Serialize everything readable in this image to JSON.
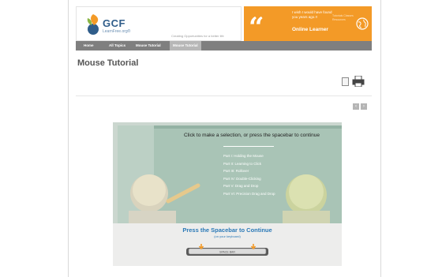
{
  "header": {
    "logo_name": "GCF",
    "logo_sub": "LearnFree.org®",
    "tagline": "Creating Opportunities for a better life",
    "banner_quote": "I wish I would have found you years ago.!!",
    "banner_name": "Online Learner",
    "banner_side": "Tutorials Classes Resources"
  },
  "nav": {
    "items": [
      "Home",
      "All Topics",
      "Mouse Tutorial",
      "Mouse Tutorial"
    ]
  },
  "page": {
    "title": "Mouse Tutorial"
  },
  "tutorial": {
    "heading": "Click to make a selection, or press the spacebar to continue",
    "menu": [
      "Part I: Holding the Mouse",
      "Part II: Learning to Click",
      "Part III: Rollover",
      "Part IV: Double-Clicking",
      "Part V: Drag and Drop",
      "Part VI: Precision Drag and Drop"
    ],
    "press": "Press the Spacebar to Continue",
    "press_sub": "(on your keyboard)",
    "spacebar_label": "SPACE BAR"
  },
  "controls": {
    "prev": "‹",
    "next": "›"
  },
  "colors": {
    "banner": "#f39a27",
    "nav": "#7f7f7f",
    "board": "#a9c4b6",
    "accent_blue": "#2a79b7"
  }
}
